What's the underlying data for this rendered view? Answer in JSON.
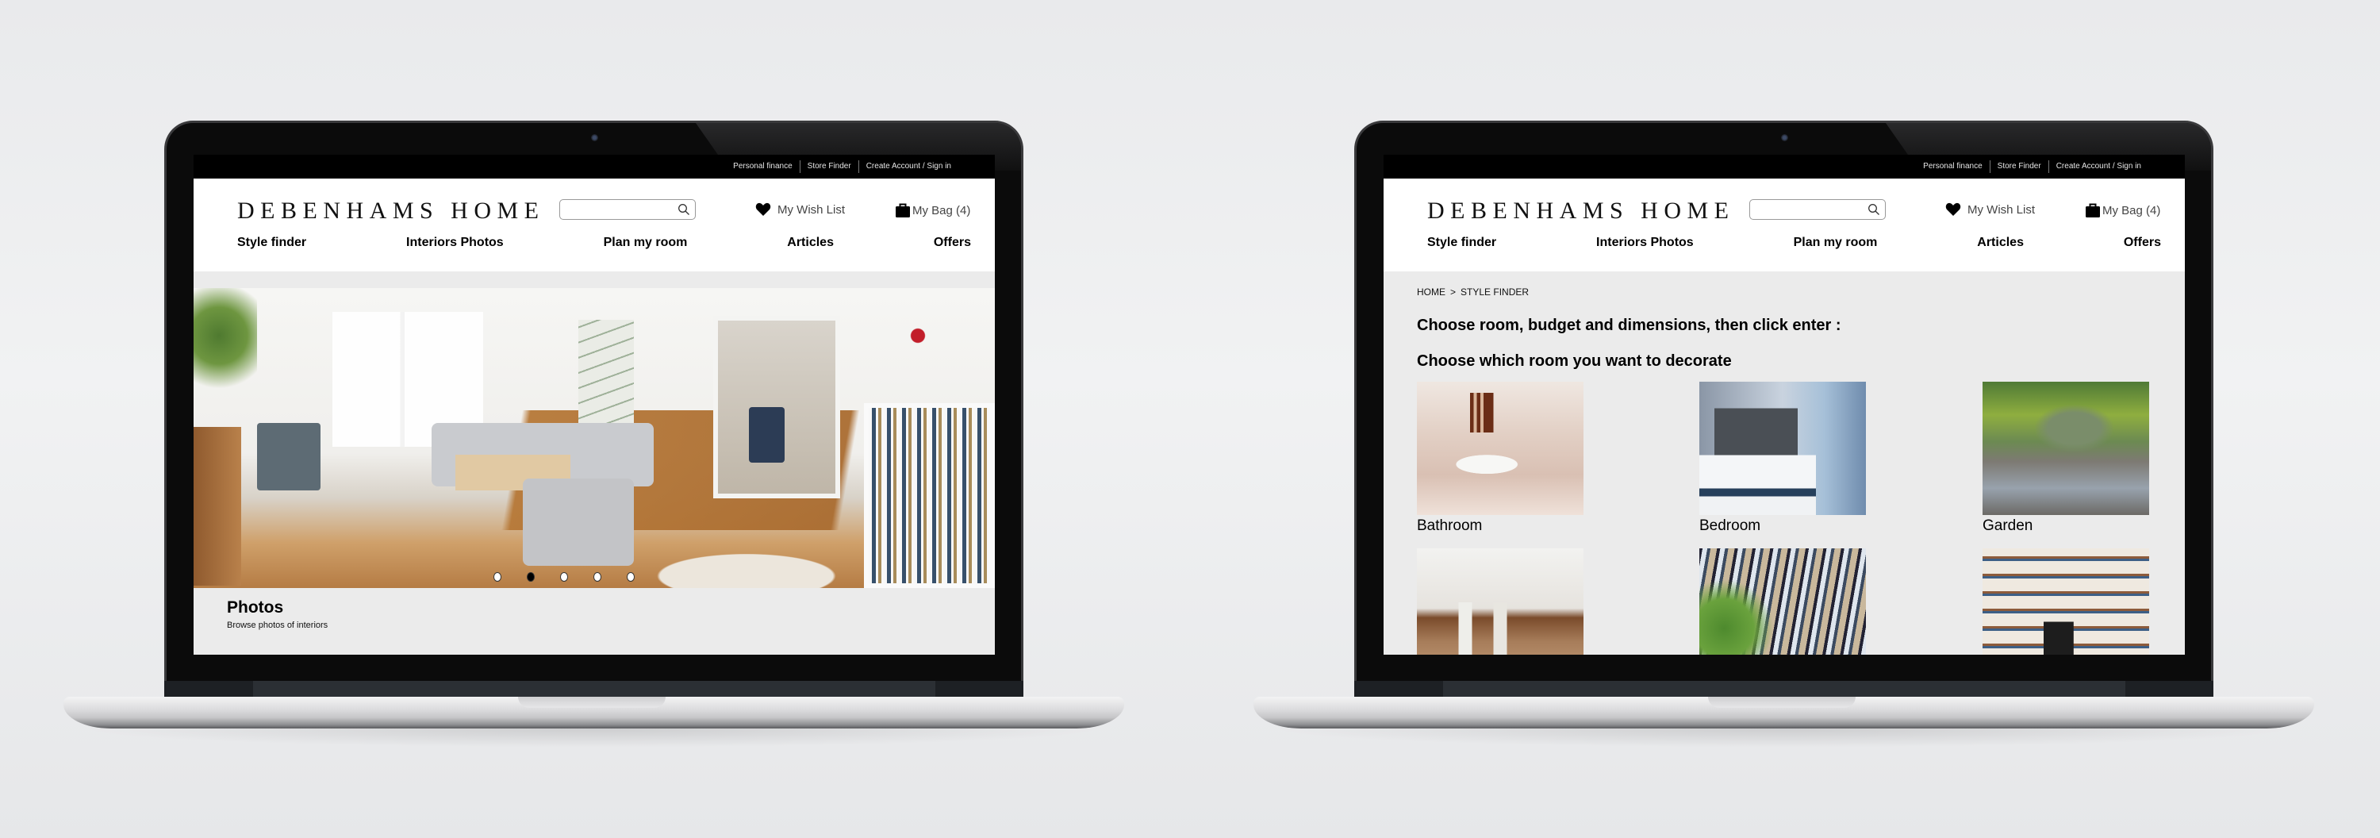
{
  "utility_links": [
    "Personal finance",
    "Store Finder",
    "Create Account / Sign in"
  ],
  "brand": "DEBENHAMS HOME",
  "search": {
    "placeholder": "",
    "value": "",
    "icon": "search-icon"
  },
  "wishlist": {
    "label": "My Wish List",
    "icon": "heart-icon"
  },
  "bag": {
    "label": "My Bag (4)",
    "count": 4,
    "icon": "shopping-bag-icon"
  },
  "nav": [
    "Style finder",
    "Interiors Photos",
    "Plan my room",
    "Articles",
    "Offers"
  ],
  "home_screen": {
    "hero_image": "living-room-photo",
    "carousel": {
      "total": 5,
      "active_index": 1
    },
    "caption_title": "Photos",
    "caption_subtitle": "Browse photos of interiors"
  },
  "style_finder_screen": {
    "breadcrumb": [
      "HOME",
      ">",
      "STYLE FINDER"
    ],
    "instruction": "Choose room, budget and dimensions, then click enter :",
    "subheading": "Choose which room you want to decorate",
    "rooms": [
      {
        "label": "Bathroom",
        "image": "bathroom-photo"
      },
      {
        "label": "Bedroom",
        "image": "bedroom-photo"
      },
      {
        "label": "Garden",
        "image": "garden-photo"
      },
      {
        "label": "",
        "image": "dining-room-photo"
      },
      {
        "label": "",
        "image": "kitchen-photo"
      },
      {
        "label": "",
        "image": "living-room-photo"
      }
    ]
  },
  "colors": {
    "top_bar": "#000000",
    "header": "#ffffff",
    "page_bg": "#ebebeb",
    "text": "#000000"
  }
}
